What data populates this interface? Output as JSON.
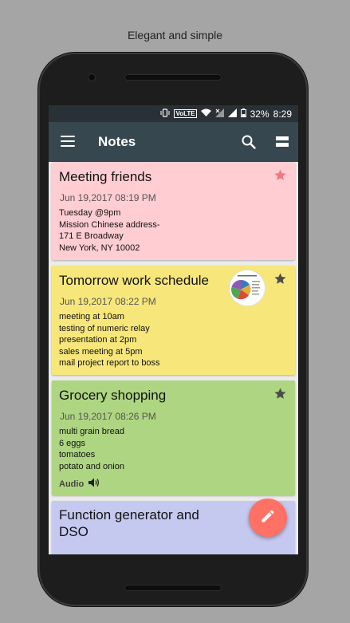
{
  "caption": "Elegant and simple",
  "status_bar": {
    "volte": "VoLTE",
    "battery": "32%",
    "time": "8:29"
  },
  "toolbar": {
    "title": "Notes",
    "menu_icon": "hamburger-menu-icon",
    "search_icon": "search-icon",
    "view_icon": "view-toggle-icon"
  },
  "notes": [
    {
      "title": "Meeting friends",
      "date": "Jun 19,2017   08:19 PM",
      "body": [
        "Tuesday @9pm",
        "Mission Chinese address-",
        "171 E Broadway",
        "New York, NY 10002"
      ],
      "color": "#ffcdd2",
      "star_color": "#ef7a7a"
    },
    {
      "title": "Tomorrow work schedule",
      "date": "Jun 19,2017   08:22 PM",
      "body": [
        "meeting at 10am",
        "testing of numeric relay",
        "presentation at 2pm",
        "sales meeting at 5pm",
        "mail project report to boss"
      ],
      "color": "#f7e77b",
      "star_color": "#4b4b4b"
    },
    {
      "title": "Grocery shopping",
      "date": "Jun 19,2017   08:26 PM",
      "body": [
        "multi grain bread",
        "6 eggs",
        "tomatoes",
        "potato and onion"
      ],
      "audio_label": "Audio",
      "color": "#aed581",
      "star_color": "#4b4b4b"
    },
    {
      "title": "Function generator and DSO",
      "color": "#c5c8ef"
    }
  ],
  "fab": {
    "icon": "edit-pencil-icon",
    "color": "#ff7165"
  }
}
